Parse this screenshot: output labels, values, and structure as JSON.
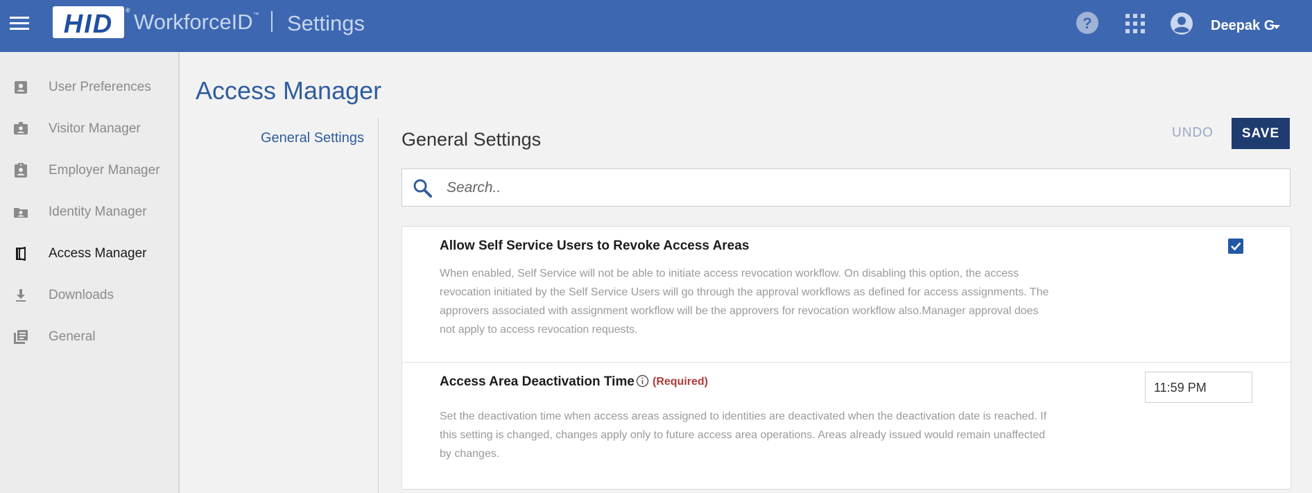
{
  "header": {
    "brand_logo": "HID",
    "brand_registered": "®",
    "product_name": "WorkforceID",
    "product_tm": "™",
    "separator": "|",
    "section": "Settings",
    "user_name": "Deepak G",
    "background_color": "#3d67b1",
    "icons": [
      "menu-icon",
      "help-icon",
      "apps-grid-icon",
      "account-circle-icon",
      "chevron-down-icon"
    ]
  },
  "sidebar": {
    "items": [
      {
        "label": "User Preferences",
        "icon": "user-badge-icon",
        "active": false
      },
      {
        "label": "Visitor Manager",
        "icon": "visitor-card-icon",
        "active": false
      },
      {
        "label": "Employer Manager",
        "icon": "clipboard-user-icon",
        "active": false
      },
      {
        "label": "Identity Manager",
        "icon": "folder-user-icon",
        "active": false
      },
      {
        "label": "Access Manager",
        "icon": "door-open-icon",
        "active": true
      },
      {
        "label": "Downloads",
        "icon": "download-icon",
        "active": false
      },
      {
        "label": "General",
        "icon": "library-books-icon",
        "active": false
      }
    ]
  },
  "main": {
    "page_title": "Access Manager",
    "subnav": {
      "active_link": "General Settings"
    },
    "section_heading": "General Settings",
    "undo_label": "UNDO",
    "save_label": "SAVE",
    "search": {
      "placeholder": "Search..",
      "value": ""
    },
    "settings": [
      {
        "title": "Allow Self Service Users to Revoke Access Areas",
        "description": "When enabled, Self Service will not be able to initiate access revocation workflow. On disabling this option, the access revocation initiated by the Self Service Users will go through the approval workflows as defined for access assignments. The approvers associated with assignment workflow will be the approvers for revocation workflow also.Manager approval does not apply to access revocation requests.",
        "control": "checkbox",
        "checked": true
      },
      {
        "title": "Access Area Deactivation Time",
        "required_label": "(Required)",
        "description": "Set the deactivation time when access areas assigned to identities are deactivated when the deactivation date is reached. If this setting is changed, changes apply only to future access area operations. Areas already issued would remain unaffected by changes.",
        "control": "time",
        "value": "11:59 PM"
      }
    ]
  },
  "colors": {
    "accent": "#2f5d9e",
    "save_button": "#1f3c70",
    "required": "#b03a3a",
    "checkbox": "#2258a5"
  }
}
